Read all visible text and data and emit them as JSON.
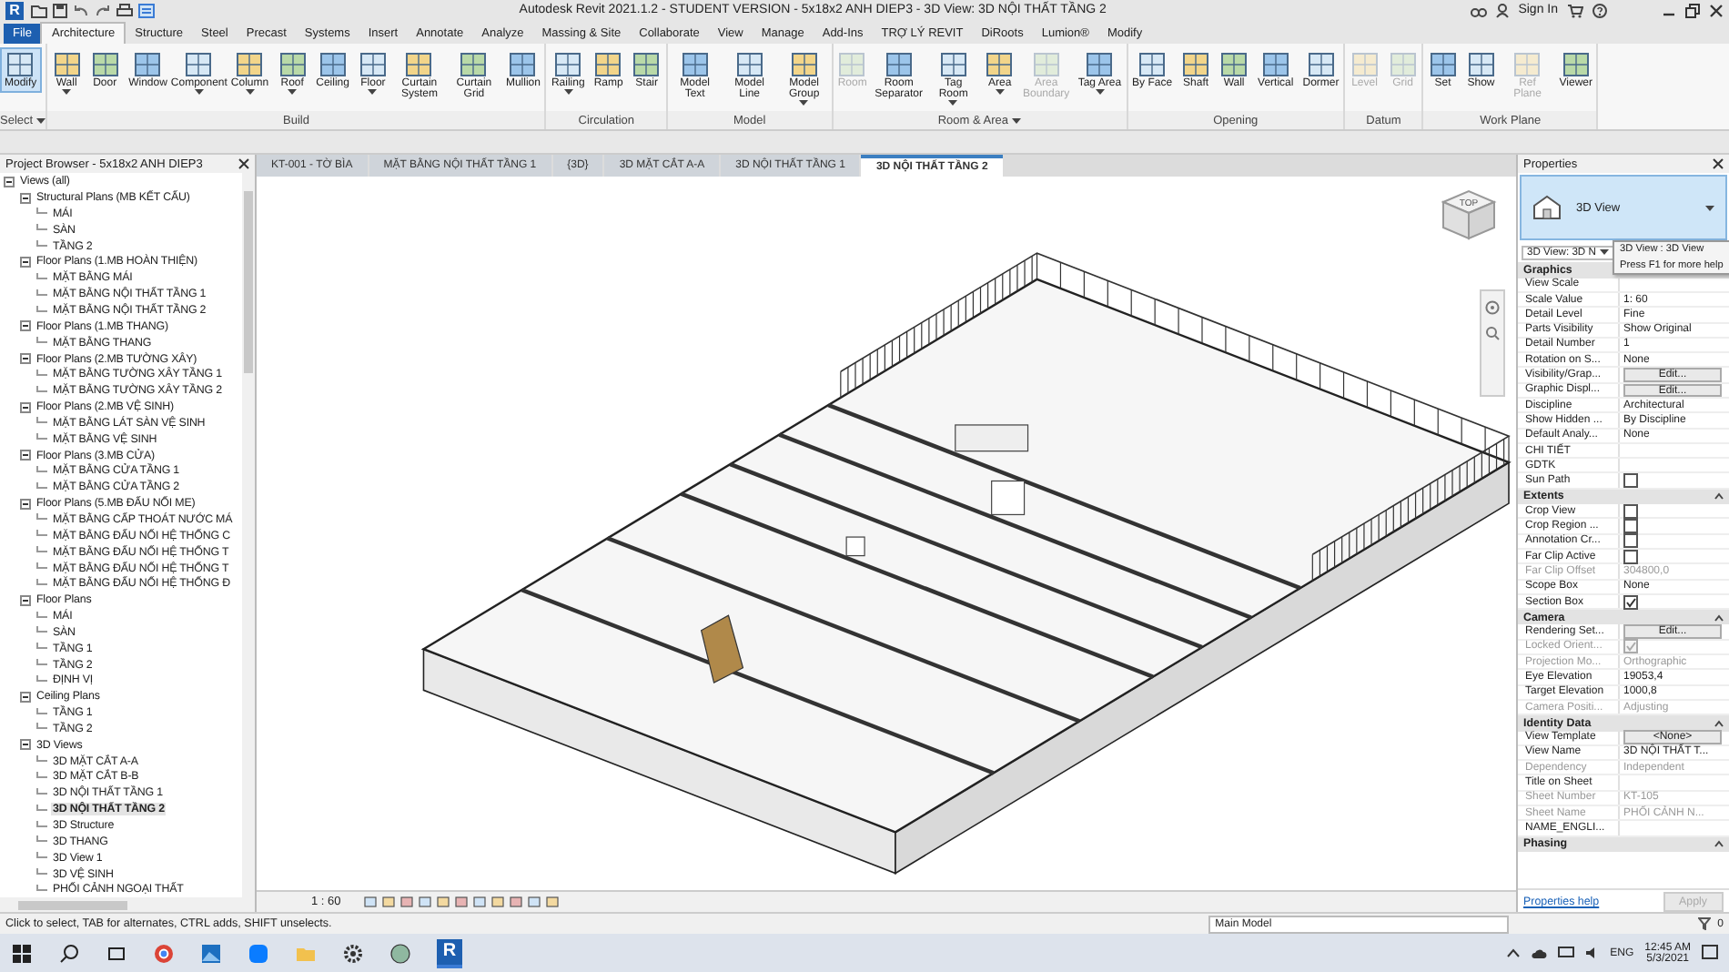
{
  "title_bar": {
    "logo": "R",
    "title": "Autodesk Revit 2021.1.2 - STUDENT VERSION - 5x18x2 ANH DIEP3 - 3D View: 3D NỘI THẤT TẦNG 2",
    "sign_in": "Sign In"
  },
  "ribbon_tabs": [
    {
      "label": "File",
      "kind": "file",
      "selected": false
    },
    {
      "label": "Architecture",
      "kind": "normal",
      "selected": true
    },
    {
      "label": "Structure",
      "kind": "normal",
      "selected": false
    },
    {
      "label": "Steel",
      "kind": "normal",
      "selected": false
    },
    {
      "label": "Precast",
      "kind": "normal",
      "selected": false
    },
    {
      "label": "Systems",
      "kind": "normal",
      "selected": false
    },
    {
      "label": "Insert",
      "kind": "normal",
      "selected": false
    },
    {
      "label": "Annotate",
      "kind": "normal",
      "selected": false
    },
    {
      "label": "Analyze",
      "kind": "normal",
      "selected": false
    },
    {
      "label": "Massing & Site",
      "kind": "normal",
      "selected": false
    },
    {
      "label": "Collaborate",
      "kind": "normal",
      "selected": false
    },
    {
      "label": "View",
      "kind": "normal",
      "selected": false
    },
    {
      "label": "Manage",
      "kind": "normal",
      "selected": false
    },
    {
      "label": "Add-Ins",
      "kind": "normal",
      "selected": false
    },
    {
      "label": "TRỢ LÝ REVIT",
      "kind": "normal",
      "selected": false
    },
    {
      "label": "DiRoots",
      "kind": "normal",
      "selected": false
    },
    {
      "label": "Lumion®",
      "kind": "normal",
      "selected": false
    },
    {
      "label": "Modify",
      "kind": "normal",
      "selected": false
    }
  ],
  "ribbon_panels": [
    {
      "label": "Select",
      "dropdown": true,
      "tools": [
        {
          "label": "Modify",
          "selected": true,
          "disabled": false,
          "dropdown": false
        }
      ]
    },
    {
      "label": "Build",
      "dropdown": false,
      "tools": [
        {
          "label": "Wall",
          "selected": false,
          "disabled": false,
          "dropdown": true
        },
        {
          "label": "Door",
          "selected": false,
          "disabled": false,
          "dropdown": false
        },
        {
          "label": "Window",
          "selected": false,
          "disabled": false,
          "dropdown": false
        },
        {
          "label": "Component",
          "selected": false,
          "disabled": false,
          "dropdown": true
        },
        {
          "label": "Column",
          "selected": false,
          "disabled": false,
          "dropdown": true
        },
        {
          "label": "Roof",
          "selected": false,
          "disabled": false,
          "dropdown": true
        },
        {
          "label": "Ceiling",
          "selected": false,
          "disabled": false,
          "dropdown": false
        },
        {
          "label": "Floor",
          "selected": false,
          "disabled": false,
          "dropdown": true
        },
        {
          "label": "Curtain System",
          "selected": false,
          "disabled": false,
          "dropdown": false
        },
        {
          "label": "Curtain Grid",
          "selected": false,
          "disabled": false,
          "dropdown": false
        },
        {
          "label": "Mullion",
          "selected": false,
          "disabled": false,
          "dropdown": false
        }
      ]
    },
    {
      "label": "Circulation",
      "dropdown": false,
      "tools": [
        {
          "label": "Railing",
          "selected": false,
          "disabled": false,
          "dropdown": true
        },
        {
          "label": "Ramp",
          "selected": false,
          "disabled": false,
          "dropdown": false
        },
        {
          "label": "Stair",
          "selected": false,
          "disabled": false,
          "dropdown": false
        }
      ]
    },
    {
      "label": "Model",
      "dropdown": false,
      "tools": [
        {
          "label": "Model Text",
          "selected": false,
          "disabled": false,
          "dropdown": false
        },
        {
          "label": "Model Line",
          "selected": false,
          "disabled": false,
          "dropdown": false
        },
        {
          "label": "Model Group",
          "selected": false,
          "disabled": false,
          "dropdown": true
        }
      ]
    },
    {
      "label": "Room & Area",
      "dropdown": true,
      "tools": [
        {
          "label": "Room",
          "selected": false,
          "disabled": true,
          "dropdown": false
        },
        {
          "label": "Room Separator",
          "selected": false,
          "disabled": false,
          "dropdown": false
        },
        {
          "label": "Tag Room",
          "selected": false,
          "disabled": false,
          "dropdown": true
        },
        {
          "label": "Area",
          "selected": false,
          "disabled": false,
          "dropdown": true
        },
        {
          "label": "Area Boundary",
          "selected": false,
          "disabled": true,
          "dropdown": false
        },
        {
          "label": "Tag Area",
          "selected": false,
          "disabled": false,
          "dropdown": true
        }
      ]
    },
    {
      "label": "Opening",
      "dropdown": false,
      "tools": [
        {
          "label": "By Face",
          "selected": false,
          "disabled": false,
          "dropdown": false
        },
        {
          "label": "Shaft",
          "selected": false,
          "disabled": false,
          "dropdown": false
        },
        {
          "label": "Wall",
          "selected": false,
          "disabled": false,
          "dropdown": false
        },
        {
          "label": "Vertical",
          "selected": false,
          "disabled": false,
          "dropdown": false
        },
        {
          "label": "Dormer",
          "selected": false,
          "disabled": false,
          "dropdown": false
        }
      ]
    },
    {
      "label": "Datum",
      "dropdown": false,
      "tools": [
        {
          "label": "Level",
          "selected": false,
          "disabled": true,
          "dropdown": false
        },
        {
          "label": "Grid",
          "selected": false,
          "disabled": true,
          "dropdown": false
        }
      ]
    },
    {
      "label": "Work Plane",
      "dropdown": false,
      "tools": [
        {
          "label": "Set",
          "selected": false,
          "disabled": false,
          "dropdown": false
        },
        {
          "label": "Show",
          "selected": false,
          "disabled": false,
          "dropdown": false
        },
        {
          "label": "Ref Plane",
          "selected": false,
          "disabled": true,
          "dropdown": false
        },
        {
          "label": "Viewer",
          "selected": false,
          "disabled": false,
          "dropdown": false
        }
      ]
    }
  ],
  "project_browser": {
    "title": "Project Browser - 5x18x2 ANH DIEP3",
    "tree": [
      {
        "label": "Views (all)",
        "expanded": true,
        "children": [
          {
            "label": "Structural Plans (MB KẾT CẤU)",
            "expanded": true,
            "children": [
              {
                "label": "MÁI",
                "selected": false
              },
              {
                "label": "SÀN",
                "selected": false
              },
              {
                "label": "TẦNG 2",
                "selected": false
              }
            ]
          },
          {
            "label": "Floor Plans (1.MB HOÀN THIỆN)",
            "expanded": true,
            "children": [
              {
                "label": "MẶT BẰNG MÁI",
                "selected": false
              },
              {
                "label": "MẶT BẰNG NỘI THẤT TẦNG 1",
                "selected": false
              },
              {
                "label": "MẶT BẰNG NỘI THẤT TẦNG 2",
                "selected": false
              }
            ]
          },
          {
            "label": "Floor Plans (1.MB THANG)",
            "expanded": true,
            "children": [
              {
                "label": "MẶT BẰNG THANG",
                "selected": false
              }
            ]
          },
          {
            "label": "Floor Plans (2.MB TƯỜNG XÂY)",
            "expanded": true,
            "children": [
              {
                "label": "MẶT BẰNG TƯỜNG XÂY TẦNG 1",
                "selected": false
              },
              {
                "label": "MẶT BẰNG TƯỜNG XÂY TẦNG 2",
                "selected": false
              }
            ]
          },
          {
            "label": "Floor Plans (2.MB VỆ SINH)",
            "expanded": true,
            "children": [
              {
                "label": "MẶT BẰNG LÁT SÀN VỆ SINH",
                "selected": false
              },
              {
                "label": "MẶT BẰNG VỆ SINH",
                "selected": false
              }
            ]
          },
          {
            "label": "Floor Plans (3.MB CỬA)",
            "expanded": true,
            "children": [
              {
                "label": "MẶT BẰNG CỬA TẦNG 1",
                "selected": false
              },
              {
                "label": "MẶT BẰNG CỬA TẦNG 2",
                "selected": false
              }
            ]
          },
          {
            "label": "Floor Plans (5.MB ĐẤU NỐI ME)",
            "expanded": true,
            "children": [
              {
                "label": "MẶT BẰNG CẤP THOÁT NƯỚC MÁ",
                "selected": false
              },
              {
                "label": "MẶT BẰNG ĐẤU NỐI HỆ THỐNG C",
                "selected": false
              },
              {
                "label": "MẶT BẰNG ĐẤU NỐI HỆ THỐNG T",
                "selected": false
              },
              {
                "label": "MẶT BẰNG ĐẤU NỐI HỆ THỐNG T",
                "selected": false
              },
              {
                "label": "MẶT BẰNG ĐẤU NỐI HỆ THỐNG Đ",
                "selected": false
              }
            ]
          },
          {
            "label": "Floor Plans",
            "expanded": true,
            "children": [
              {
                "label": "MÁI",
                "selected": false
              },
              {
                "label": "SÀN",
                "selected": false
              },
              {
                "label": "TẦNG 1",
                "selected": false
              },
              {
                "label": "TẦNG 2",
                "selected": false
              },
              {
                "label": "ĐỊNH VỊ",
                "selected": false
              }
            ]
          },
          {
            "label": "Ceiling Plans",
            "expanded": true,
            "children": [
              {
                "label": "TẦNG 1",
                "selected": false
              },
              {
                "label": "TẦNG 2",
                "selected": false
              }
            ]
          },
          {
            "label": "3D Views",
            "expanded": true,
            "children": [
              {
                "label": "3D MẶT CẮT A-A",
                "selected": false
              },
              {
                "label": "3D MẶT CẮT B-B",
                "selected": false
              },
              {
                "label": "3D NỘI THẤT TẦNG 1",
                "selected": false
              },
              {
                "label": "3D NỘI THẤT TẦNG 2",
                "selected": true
              },
              {
                "label": "3D Structure",
                "selected": false
              },
              {
                "label": "3D THANG",
                "selected": false
              },
              {
                "label": "3D View 1",
                "selected": false
              },
              {
                "label": "3D VỆ SINH",
                "selected": false
              },
              {
                "label": "PHỐI CẢNH NGOẠI THẤT",
                "selected": false
              }
            ]
          }
        ]
      }
    ]
  },
  "view_tabs": [
    {
      "label": "KT-001 - TỜ BÌA",
      "selected": false
    },
    {
      "label": "MẶT BẰNG NỘI THẤT TẦNG 1",
      "selected": false
    },
    {
      "label": "{3D}",
      "selected": false
    },
    {
      "label": "3D MẶT CẮT A-A",
      "selected": false
    },
    {
      "label": "3D NỘI THẤT TẦNG 1",
      "selected": false
    },
    {
      "label": "3D NỘI THẤT TẦNG 2",
      "selected": true
    }
  ],
  "view": {
    "viewcube_label": "TOP",
    "scale": "1 : 60"
  },
  "properties": {
    "title": "Properties",
    "type_name": "3D View",
    "instance_selector": "3D View: 3D N",
    "tooltip": {
      "title": "3D View : 3D View",
      "hint": "Press F1 for more help"
    },
    "sections": [
      {
        "title": "Graphics",
        "rows": [
          {
            "label": "View Scale",
            "kind": "text",
            "disabled": false
          },
          {
            "label": "Scale Value",
            "value": "1: 60",
            "kind": "text",
            "disabled": false
          },
          {
            "label": "Detail Level",
            "value": "Fine",
            "kind": "text",
            "disabled": false
          },
          {
            "label": "Parts Visibility",
            "value": "Show Original",
            "kind": "text",
            "disabled": false
          },
          {
            "label": "Detail Number",
            "value": "1",
            "kind": "text",
            "disabled": false
          },
          {
            "label": "Rotation on S...",
            "value": "None",
            "kind": "text",
            "disabled": false
          },
          {
            "label": "Visibility/Grap...",
            "value": "Edit...",
            "kind": "button",
            "disabled": false
          },
          {
            "label": "Graphic Displ...",
            "value": "Edit...",
            "kind": "button",
            "disabled": false
          },
          {
            "label": "Discipline",
            "value": "Architectural",
            "kind": "text",
            "disabled": false
          },
          {
            "label": "Show Hidden ...",
            "value": "By Discipline",
            "kind": "text",
            "disabled": false
          },
          {
            "label": "Default Analy...",
            "value": "None",
            "kind": "text",
            "disabled": false
          },
          {
            "label": "CHI TIẾT",
            "kind": "text",
            "disabled": false
          },
          {
            "label": "GDTK",
            "kind": "text",
            "disabled": false
          },
          {
            "label": "Sun Path",
            "kind": "checkbox",
            "checked": false,
            "disabled": false
          }
        ]
      },
      {
        "title": "Extents",
        "rows": [
          {
            "label": "Crop View",
            "kind": "checkbox",
            "checked": false,
            "disabled": false
          },
          {
            "label": "Crop Region ...",
            "kind": "checkbox",
            "checked": false,
            "disabled": false
          },
          {
            "label": "Annotation Cr...",
            "kind": "checkbox",
            "checked": false,
            "disabled": false
          },
          {
            "label": "Far Clip Active",
            "kind": "checkbox",
            "checked": false,
            "disabled": false
          },
          {
            "label": "Far Clip Offset",
            "value": "304800,0",
            "kind": "text",
            "disabled": true
          },
          {
            "label": "Scope Box",
            "value": "None",
            "kind": "text",
            "disabled": false
          },
          {
            "label": "Section Box",
            "kind": "checkbox",
            "checked": true,
            "disabled": false
          }
        ]
      },
      {
        "title": "Camera",
        "rows": [
          {
            "label": "Rendering Set...",
            "value": "Edit...",
            "kind": "button",
            "disabled": false
          },
          {
            "label": "Locked Orient...",
            "kind": "checkbox",
            "checked": true,
            "disabled": true
          },
          {
            "label": "Projection Mo...",
            "value": "Orthographic",
            "kind": "text",
            "disabled": true
          },
          {
            "label": "Eye Elevation",
            "value": "19053,4",
            "kind": "text",
            "disabled": false
          },
          {
            "label": "Target Elevation",
            "value": "1000,8",
            "kind": "text",
            "disabled": false
          },
          {
            "label": "Camera Positi...",
            "value": "Adjusting",
            "kind": "text",
            "disabled": true
          }
        ]
      },
      {
        "title": "Identity Data",
        "rows": [
          {
            "label": "View Template",
            "value": "<None>",
            "kind": "button",
            "disabled": false
          },
          {
            "label": "View Name",
            "value": "3D NỘI THẤT T...",
            "kind": "text",
            "disabled": false
          },
          {
            "label": "Dependency",
            "value": "Independent",
            "kind": "text",
            "disabled": true
          },
          {
            "label": "Title on Sheet",
            "kind": "text",
            "disabled": false
          },
          {
            "label": "Sheet Number",
            "value": "KT-105",
            "kind": "text",
            "disabled": true
          },
          {
            "label": "Sheet Name",
            "value": "PHỐI CẢNH N...",
            "kind": "text",
            "disabled": true
          },
          {
            "label": "NAME_ENGLI...",
            "kind": "text",
            "disabled": false
          }
        ]
      },
      {
        "title": "Phasing"
      }
    ],
    "help_link": "Properties help",
    "apply": "Apply"
  },
  "status_bar": {
    "message": "Click to select, TAB for alternates, CTRL adds, SHIFT unselects.",
    "model": "Main Model",
    "filter_count": "0"
  },
  "taskbar": {
    "revit_logo": "R",
    "language": "ENG",
    "time": "12:45 AM",
    "date": "5/3/2021"
  }
}
